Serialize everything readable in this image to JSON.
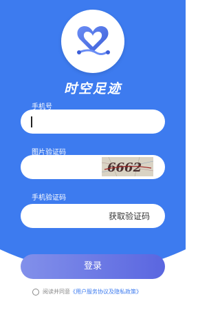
{
  "app": {
    "title": "时空足迹"
  },
  "phone": {
    "label": "手机号",
    "value": ""
  },
  "captcha": {
    "label": "图片验证码",
    "value": "",
    "image_text": "6662"
  },
  "sms": {
    "label": "手机验证码",
    "value": "",
    "button_label": "获取验证码"
  },
  "login": {
    "button_label": "登录"
  },
  "agreement": {
    "prefix": "阅读并同意",
    "link_text": "《用户服务协议及隐私政策》"
  },
  "colors": {
    "primary": "#3d7bef",
    "button_start": "#8290ea",
    "button_end": "#5a66e0"
  },
  "icons": {
    "logo": "heart-path-icon",
    "radio": "radio-unchecked-icon"
  }
}
